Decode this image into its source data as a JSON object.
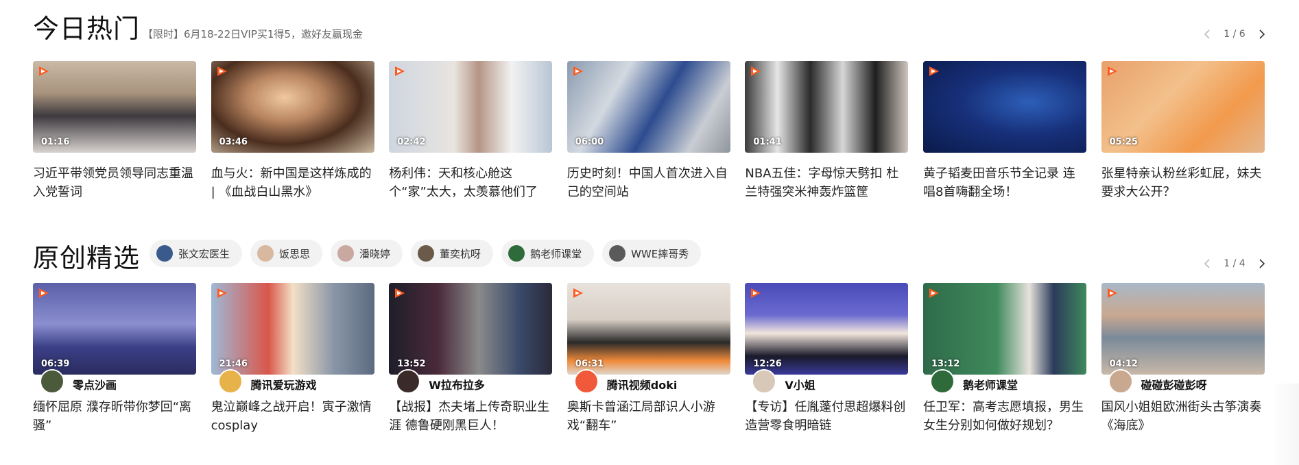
{
  "hot": {
    "title": "今日热门",
    "subtitle": "【限时】6月18-22日VIP买1得5，邀好友赢现金",
    "pager": "1 / 6",
    "videos": [
      {
        "duration": "01:16",
        "caption": "习近平带领党员领导同志重温入党誓词",
        "bg": "linear-gradient(180deg,#c9b9a6 0%,#a8937d 35%,#3d3a3f 60%,#d8d2cf 100%)"
      },
      {
        "duration": "03:46",
        "caption": "血与火：新中国是这样炼成的 | 《血战白山黑水》",
        "bg": "radial-gradient(ellipse at 45% 40%,#f0c9a0 0%,#b88560 30%,#4a2d1e 60%,#c9b8a0 100%)"
      },
      {
        "duration": "02:42",
        "caption": "杨利伟：天和核心舱这个“家”太大，太羡慕他们了",
        "bg": "linear-gradient(90deg,#cfd6df 0%,#e8e4e0 40%,#b59585 55%,#f2f2f2 75%,#b8c6d4 100%)"
      },
      {
        "duration": "06:00",
        "caption": "历史时刻！中国人首次进入自己的空间站",
        "bg": "linear-gradient(120deg,#8a9bb0 0%,#d3d9e0 30%,#2d4c8f 55%,#c9cdd3 80%,#8f959c 100%)"
      },
      {
        "duration": "01:41",
        "caption": "NBA五佳：字母惊天劈扣 杜兰特强突米神轰炸篮筐",
        "bg": "linear-gradient(90deg,#3a3a3a 0%,#e6e6e6 20%,#2a2a2a 40%,#d6d6d6 60%,#1f1f1f 80%,#cfc6bd 100%)"
      },
      {
        "duration": "",
        "caption": "黄子韬麦田音乐节全记录 连唱8首嗨翻全场！",
        "bg": "radial-gradient(ellipse at 65% 45%,#2d5fb8 0%,#17307a 45%,#0b1a4a 100%)"
      },
      {
        "duration": "05:25",
        "caption": "张星特亲认粉丝彩虹屁，妹夫要求大公开？",
        "bg": "linear-gradient(135deg,#e8a06b 0%,#f3c08b 40%,#f29a4d 70%,#e4b78f 100%)"
      }
    ]
  },
  "original": {
    "title": "原创精选",
    "pager": "1 / 4",
    "chips": [
      {
        "label": "张文宏医生",
        "avatar_color": "#3a5a8c"
      },
      {
        "label": "饭思思",
        "avatar_color": "#d9b8a0"
      },
      {
        "label": "潘晓婷",
        "avatar_color": "#c9a8a0"
      },
      {
        "label": "董奕杭呀",
        "avatar_color": "#6b5a4a"
      },
      {
        "label": "鹅老师课堂",
        "avatar_color": "#2f6b3a"
      },
      {
        "label": "WWE摔哥秀",
        "avatar_color": "#5a5a5a"
      }
    ],
    "videos": [
      {
        "duration": "06:39",
        "uploader": "零点沙画",
        "caption": "缅怀屈原 濮存昕带你梦回“离骚”",
        "bg": "linear-gradient(180deg,#5a5fa8 0%,#8b8fd0 45%,#3b3f86 70%,#2a2c60 100%)",
        "avatar_color": "#4a5a3a"
      },
      {
        "duration": "21:46",
        "uploader": "腾讯爱玩游戏",
        "caption": "鬼泣巅峰之战开启！寅子激情cosplay",
        "bg": "linear-gradient(90deg,#9fb8d6 0%,#d9574a 35%,#f2e0c6 50%,#8a96a8 75%,#5c6a80 100%)",
        "avatar_color": "#e8b24a"
      },
      {
        "duration": "13:52",
        "uploader": "W拉布拉多",
        "caption": "【战报】杰夫堵上传奇职业生涯 德鲁硬刚黑巨人！",
        "bg": "linear-gradient(90deg,#1e1e2a 0%,#4a2a3a 30%,#8a8a8a 55%,#3a4a6a 80%,#2a2a3a 100%)",
        "avatar_color": "#3a2a2a"
      },
      {
        "duration": "06:31",
        "uploader": "腾讯视频doki",
        "caption": "奥斯卡曾涵江局部识人小游戏“翻车”",
        "bg": "linear-gradient(180deg,#e8e2dc 0%,#d8cfc6 40%,#2a2a2a 65%,#f08a3a 85%,#e0d6cc 100%)",
        "avatar_color": "#f05a3a"
      },
      {
        "duration": "12:26",
        "uploader": "V小姐",
        "caption": "【专访】任胤蓬付思超爆料创造营零食明暗链",
        "bg": "linear-gradient(180deg,#4a4ab8 0%,#6a6ad0 35%,#f2e6dc 55%,#1a1a2a 80%,#3a3a9a 100%)",
        "avatar_color": "#d8c8b8"
      },
      {
        "duration": "13:12",
        "uploader": "鹅老师课堂",
        "caption": "任卫军：高考志愿填报，男生女生分别如何做好规划？",
        "bg": "linear-gradient(90deg,#2f6b4a 0%,#3f8a5c 45%,#e6e2dc 65%,#2a3a5a 80%,#3f8a5c 100%)",
        "avatar_color": "#2f6b3a"
      },
      {
        "duration": "04:12",
        "uploader": "碰碰彭碰彭呀",
        "caption": "国风小姐姐欧洲街头古筝演奏《海底》",
        "bg": "linear-gradient(180deg,#a8b8c8 0%,#c9a890 35%,#7a8a9a 60%,#c8b8a8 100%)",
        "avatar_color": "#c9a890"
      }
    ]
  },
  "icons": {
    "prev": "chevron-left-icon",
    "next": "chevron-right-icon",
    "play_badge": "play-badge-icon"
  }
}
